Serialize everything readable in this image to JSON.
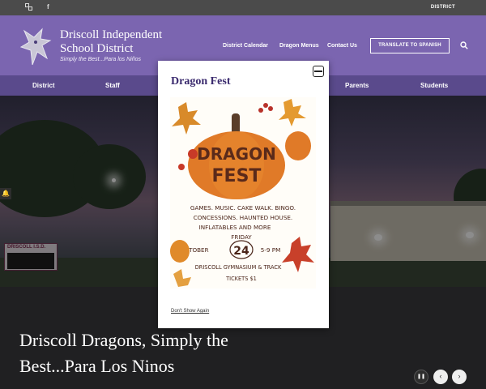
{
  "utility_bar": {
    "district_link": "DISTRICT",
    "icons": [
      "translate-icon",
      "facebook-icon"
    ]
  },
  "header": {
    "title_line1": "Driscoll Independent",
    "title_line2": "School District",
    "tagline": "Simply the Best...Para los Niños",
    "links": [
      "District Calendar",
      "Dragon Menus",
      "Contact Us"
    ],
    "translate_button": "TRANSLATE TO SPANISH",
    "search_icon": "search-icon",
    "colors": {
      "header": "#7b65b0",
      "nav": "#5a4a8c",
      "util": "#4b4b4b"
    }
  },
  "nav": {
    "items": [
      "District",
      "Staff",
      "Parents",
      "Students"
    ]
  },
  "hero": {
    "sign_text": "DRISCOLL I.S.D.",
    "headline_line1": "Driscoll Dragons, Simply the",
    "headline_line2": "Best...Para Los Ninos",
    "controls": {
      "pause": "❚❚",
      "prev": "‹",
      "next": "›"
    }
  },
  "modal": {
    "title": "Dragon Fest",
    "dont_show": "Don't Show Again",
    "flyer": {
      "word1": "DRAGON",
      "word2": "FEST",
      "activities_line1": "GAMES. MUSIC. CAKE WALK. BINGO.",
      "activities_line2": "CONCESSIONS. HAUNTED HOUSE.",
      "activities_line3": "INFLATABLES AND MORE",
      "day": "FRIDAY",
      "month": "OCTOBER",
      "date": "24",
      "time": "5-9 PM",
      "location": "DRISCOLL GYMNASIUM & TRACK",
      "tickets": "TICKETS $1"
    }
  }
}
